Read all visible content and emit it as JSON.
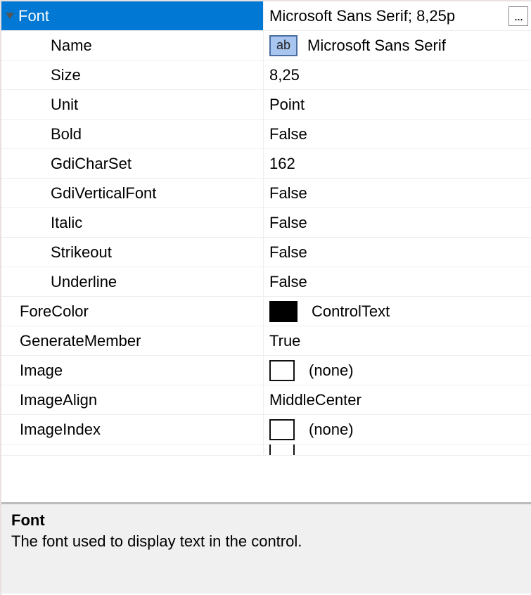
{
  "selected": {
    "label": "Font",
    "value": "Microsoft Sans Serif; 8,25p",
    "ellipsis": "..."
  },
  "font_children": {
    "name": {
      "label": "Name",
      "value": "Microsoft Sans Serif",
      "ab": "ab"
    },
    "size": {
      "label": "Size",
      "value": "8,25"
    },
    "unit": {
      "label": "Unit",
      "value": "Point"
    },
    "bold": {
      "label": "Bold",
      "value": "False"
    },
    "gdicharset": {
      "label": "GdiCharSet",
      "value": "162"
    },
    "gdivert": {
      "label": "GdiVerticalFont",
      "value": "False"
    },
    "italic": {
      "label": "Italic",
      "value": "False"
    },
    "strikeout": {
      "label": "Strikeout",
      "value": "False"
    },
    "underline": {
      "label": "Underline",
      "value": "False"
    }
  },
  "props": {
    "forecolor": {
      "label": "ForeColor",
      "value": "ControlText"
    },
    "genmember": {
      "label": "GenerateMember",
      "value": "True"
    },
    "image": {
      "label": "Image",
      "value": "(none)"
    },
    "imagealign": {
      "label": "ImageAlign",
      "value": "MiddleCenter"
    },
    "imageindex": {
      "label": "ImageIndex",
      "value": "(none)"
    }
  },
  "description": {
    "title": "Font",
    "text": "The font used to display text in the control."
  }
}
